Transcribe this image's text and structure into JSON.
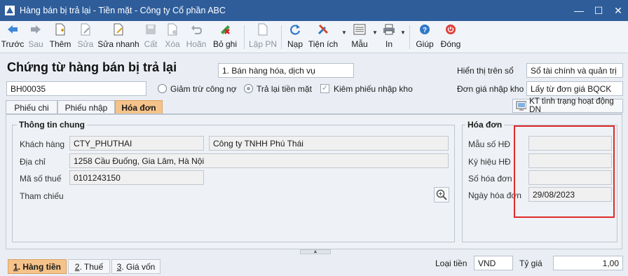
{
  "window": {
    "title": "Hàng bán bị trả lại - Tiền mặt - Công ty Cổ phần ABC",
    "minimize": "—",
    "maximize": "☐",
    "close": "✕"
  },
  "toolbar": {
    "buttons": [
      {
        "label": "Trước",
        "icon": "arrow-left-icon",
        "enabled": true
      },
      {
        "label": "Sau",
        "icon": "arrow-right-icon",
        "enabled": false
      },
      {
        "label": "Thêm",
        "icon": "add-document-icon",
        "enabled": true
      },
      {
        "label": "Sửa",
        "icon": "edit-document-icon",
        "enabled": false
      },
      {
        "label": "Sửa nhanh",
        "icon": "quick-edit-icon",
        "enabled": true
      },
      {
        "label": "Cất",
        "icon": "save-icon",
        "enabled": false
      },
      {
        "label": "Xóa",
        "icon": "delete-icon",
        "enabled": false
      },
      {
        "label": "Hoãn",
        "icon": "undo-icon",
        "enabled": false
      },
      {
        "label": "Bỏ ghi",
        "icon": "unpost-icon",
        "enabled": true
      },
      {
        "label": "Lập PN",
        "icon": "create-receipt-icon",
        "enabled": false
      },
      {
        "label": "Nạp",
        "icon": "refresh-icon",
        "enabled": true
      },
      {
        "label": "Tiện ích",
        "icon": "tools-icon",
        "enabled": true
      },
      {
        "label": "Mẫu",
        "icon": "template-icon",
        "enabled": true
      },
      {
        "label": "In",
        "icon": "print-icon",
        "enabled": true
      },
      {
        "label": "Giúp",
        "icon": "help-icon",
        "enabled": true
      },
      {
        "label": "Đóng",
        "icon": "power-icon",
        "enabled": true
      }
    ]
  },
  "header": {
    "doc_title": "Chứng từ hàng bán bị trả lại",
    "sale_type": "1. Bán hàng hóa, dịch vụ",
    "display_on_book_label": "Hiển thị trên sổ",
    "display_on_book_value": "Sổ tài chính và quản trị",
    "doc_number": "BH00035",
    "radio_reduce_debt": "Giảm trừ công nợ",
    "radio_cash_return": "Trả lại tiền mặt",
    "check_receipt": "Kiêm phiếu nhập kho",
    "import_price_label": "Đơn giá nhập kho",
    "import_price_value": "Lấy từ đơn giá BQCK"
  },
  "tabs": [
    "Phiếu chi",
    "Phiếu nhập",
    "Hóa đơn"
  ],
  "kt_button": "KT tình trạng hoạt động DN",
  "general_info": {
    "title": "Thông tin chung",
    "customer_label": "Khách hàng",
    "customer_code": "CTY_PHUTHAI",
    "customer_name": "Công ty TNHH Phú Thái",
    "address_label": "Địa chỉ",
    "address": "1258 Cầu Đuống, Gia Lâm, Hà Nội",
    "tax_label": "Mã số thuế",
    "tax_code": "0101243150",
    "reference_label": "Tham chiếu"
  },
  "invoice": {
    "title": "Hóa đơn",
    "template_label": "Mẫu số HĐ",
    "template_value": "",
    "symbol_label": "Ký hiệu HĐ",
    "symbol_value": "",
    "number_label": "Số hóa đơn",
    "number_value": "",
    "date_label": "Ngày hóa đơn",
    "date_value": "29/08/2023"
  },
  "bottom": {
    "tabs": [
      {
        "key": "1",
        "label": ". Hàng tiền"
      },
      {
        "key": "2",
        "label": ". Thuế"
      },
      {
        "key": "3",
        "label": ". Giá vốn"
      }
    ],
    "currency_label": "Loại tiền",
    "currency_value": "VND",
    "rate_label": "Tỷ giá",
    "rate_value": "1,00"
  },
  "colors": {
    "titlebar": "#2e5d9a",
    "active_tab": "#f5c38a",
    "highlight": "#e02a2a"
  }
}
